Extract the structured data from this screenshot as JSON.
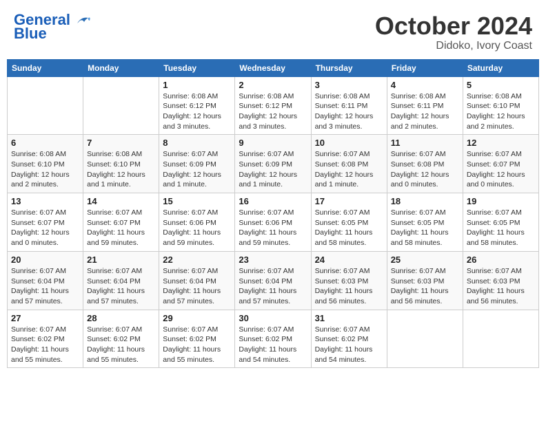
{
  "logo": {
    "line1": "General",
    "line2": "Blue"
  },
  "title": "October 2024",
  "subtitle": "Didoko, Ivory Coast",
  "weekdays": [
    "Sunday",
    "Monday",
    "Tuesday",
    "Wednesday",
    "Thursday",
    "Friday",
    "Saturday"
  ],
  "weeks": [
    [
      {
        "day": "",
        "info": ""
      },
      {
        "day": "",
        "info": ""
      },
      {
        "day": "1",
        "info": "Sunrise: 6:08 AM\nSunset: 6:12 PM\nDaylight: 12 hours and 3 minutes."
      },
      {
        "day": "2",
        "info": "Sunrise: 6:08 AM\nSunset: 6:12 PM\nDaylight: 12 hours and 3 minutes."
      },
      {
        "day": "3",
        "info": "Sunrise: 6:08 AM\nSunset: 6:11 PM\nDaylight: 12 hours and 3 minutes."
      },
      {
        "day": "4",
        "info": "Sunrise: 6:08 AM\nSunset: 6:11 PM\nDaylight: 12 hours and 2 minutes."
      },
      {
        "day": "5",
        "info": "Sunrise: 6:08 AM\nSunset: 6:10 PM\nDaylight: 12 hours and 2 minutes."
      }
    ],
    [
      {
        "day": "6",
        "info": "Sunrise: 6:08 AM\nSunset: 6:10 PM\nDaylight: 12 hours and 2 minutes."
      },
      {
        "day": "7",
        "info": "Sunrise: 6:08 AM\nSunset: 6:10 PM\nDaylight: 12 hours and 1 minute."
      },
      {
        "day": "8",
        "info": "Sunrise: 6:07 AM\nSunset: 6:09 PM\nDaylight: 12 hours and 1 minute."
      },
      {
        "day": "9",
        "info": "Sunrise: 6:07 AM\nSunset: 6:09 PM\nDaylight: 12 hours and 1 minute."
      },
      {
        "day": "10",
        "info": "Sunrise: 6:07 AM\nSunset: 6:08 PM\nDaylight: 12 hours and 1 minute."
      },
      {
        "day": "11",
        "info": "Sunrise: 6:07 AM\nSunset: 6:08 PM\nDaylight: 12 hours and 0 minutes."
      },
      {
        "day": "12",
        "info": "Sunrise: 6:07 AM\nSunset: 6:07 PM\nDaylight: 12 hours and 0 minutes."
      }
    ],
    [
      {
        "day": "13",
        "info": "Sunrise: 6:07 AM\nSunset: 6:07 PM\nDaylight: 12 hours and 0 minutes."
      },
      {
        "day": "14",
        "info": "Sunrise: 6:07 AM\nSunset: 6:07 PM\nDaylight: 11 hours and 59 minutes."
      },
      {
        "day": "15",
        "info": "Sunrise: 6:07 AM\nSunset: 6:06 PM\nDaylight: 11 hours and 59 minutes."
      },
      {
        "day": "16",
        "info": "Sunrise: 6:07 AM\nSunset: 6:06 PM\nDaylight: 11 hours and 59 minutes."
      },
      {
        "day": "17",
        "info": "Sunrise: 6:07 AM\nSunset: 6:05 PM\nDaylight: 11 hours and 58 minutes."
      },
      {
        "day": "18",
        "info": "Sunrise: 6:07 AM\nSunset: 6:05 PM\nDaylight: 11 hours and 58 minutes."
      },
      {
        "day": "19",
        "info": "Sunrise: 6:07 AM\nSunset: 6:05 PM\nDaylight: 11 hours and 58 minutes."
      }
    ],
    [
      {
        "day": "20",
        "info": "Sunrise: 6:07 AM\nSunset: 6:04 PM\nDaylight: 11 hours and 57 minutes."
      },
      {
        "day": "21",
        "info": "Sunrise: 6:07 AM\nSunset: 6:04 PM\nDaylight: 11 hours and 57 minutes."
      },
      {
        "day": "22",
        "info": "Sunrise: 6:07 AM\nSunset: 6:04 PM\nDaylight: 11 hours and 57 minutes."
      },
      {
        "day": "23",
        "info": "Sunrise: 6:07 AM\nSunset: 6:04 PM\nDaylight: 11 hours and 57 minutes."
      },
      {
        "day": "24",
        "info": "Sunrise: 6:07 AM\nSunset: 6:03 PM\nDaylight: 11 hours and 56 minutes."
      },
      {
        "day": "25",
        "info": "Sunrise: 6:07 AM\nSunset: 6:03 PM\nDaylight: 11 hours and 56 minutes."
      },
      {
        "day": "26",
        "info": "Sunrise: 6:07 AM\nSunset: 6:03 PM\nDaylight: 11 hours and 56 minutes."
      }
    ],
    [
      {
        "day": "27",
        "info": "Sunrise: 6:07 AM\nSunset: 6:02 PM\nDaylight: 11 hours and 55 minutes."
      },
      {
        "day": "28",
        "info": "Sunrise: 6:07 AM\nSunset: 6:02 PM\nDaylight: 11 hours and 55 minutes."
      },
      {
        "day": "29",
        "info": "Sunrise: 6:07 AM\nSunset: 6:02 PM\nDaylight: 11 hours and 55 minutes."
      },
      {
        "day": "30",
        "info": "Sunrise: 6:07 AM\nSunset: 6:02 PM\nDaylight: 11 hours and 54 minutes."
      },
      {
        "day": "31",
        "info": "Sunrise: 6:07 AM\nSunset: 6:02 PM\nDaylight: 11 hours and 54 minutes."
      },
      {
        "day": "",
        "info": ""
      },
      {
        "day": "",
        "info": ""
      }
    ]
  ]
}
